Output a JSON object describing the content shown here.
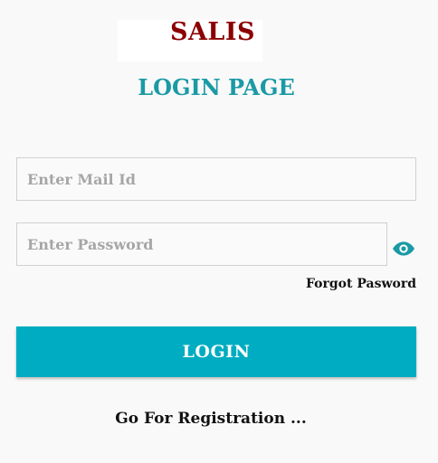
{
  "header": {
    "brand": "SALIS",
    "title": "LOGIN PAGE"
  },
  "form": {
    "mail_placeholder": "Enter Mail Id",
    "mail_value": "",
    "password_placeholder": "Enter Password",
    "password_value": "",
    "forgot_label": "Forgot Pasword",
    "login_label": "LOGIN",
    "register_label": "Go For Registration ..."
  },
  "icons": {
    "password_toggle": "eye-icon"
  },
  "colors": {
    "brand": "#8b0000",
    "title": "#1a9aa5",
    "accent": "#00acc1",
    "eye": "#1a9aa5"
  }
}
